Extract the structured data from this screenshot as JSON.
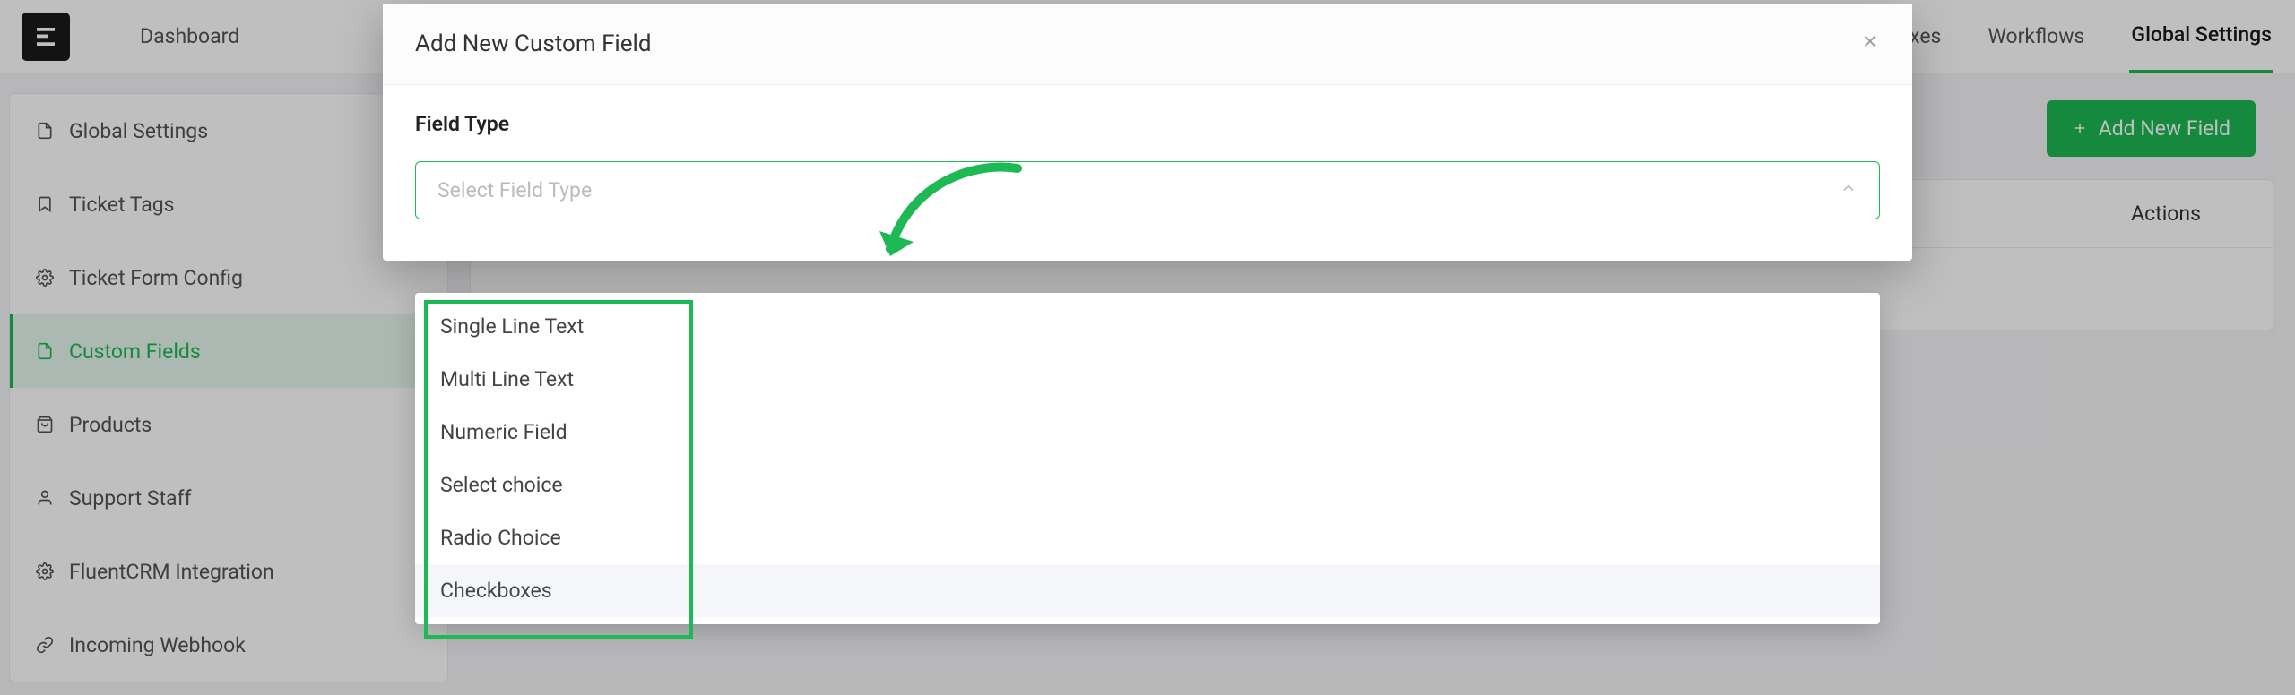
{
  "nav": {
    "dashboard": "Dashboard",
    "business_inboxes": "Business Inboxes",
    "workflows": "Workflows",
    "global_settings": "Global Settings"
  },
  "sidebar": {
    "items": [
      {
        "label": "Global Settings",
        "icon": "file-icon"
      },
      {
        "label": "Ticket Tags",
        "icon": "bookmark-icon"
      },
      {
        "label": "Ticket Form Config",
        "icon": "gear-icon"
      },
      {
        "label": "Custom Fields",
        "icon": "file-icon"
      },
      {
        "label": "Products",
        "icon": "bag-icon"
      },
      {
        "label": "Support Staff",
        "icon": "user-icon"
      },
      {
        "label": "FluentCRM Integration",
        "icon": "gear-icon"
      },
      {
        "label": "Incoming Webhook",
        "icon": "link-icon"
      }
    ]
  },
  "main": {
    "add_button_label": "Add New Field",
    "table_actions_header": "Actions"
  },
  "modal": {
    "title": "Add New Custom Field",
    "field_type_label": "Field Type",
    "select_placeholder": "Select Field Type",
    "options": [
      "Single Line Text",
      "Multi Line Text",
      "Numeric Field",
      "Select choice",
      "Radio Choice",
      "Checkboxes"
    ]
  }
}
